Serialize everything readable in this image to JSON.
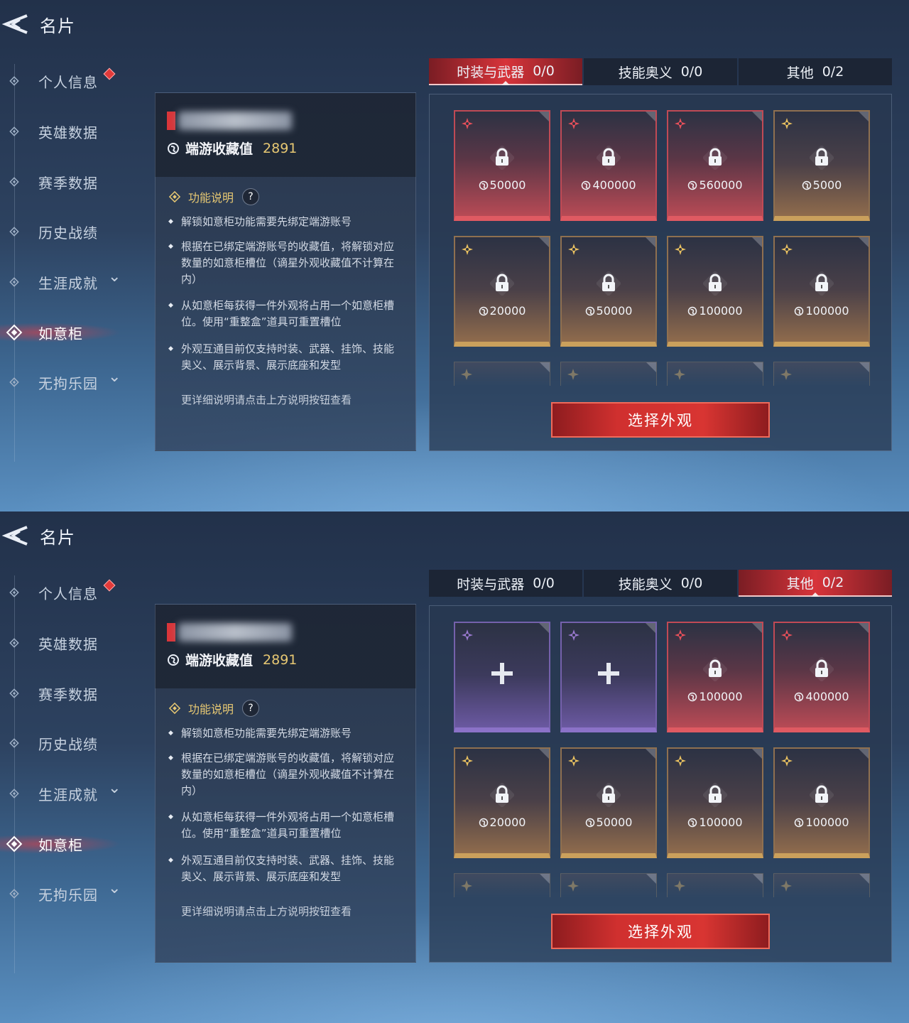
{
  "screens": [
    {
      "header": {
        "title": "名片"
      },
      "sidebar": {
        "items": [
          {
            "label": "个人信息",
            "has_dot": true,
            "has_chevron": false,
            "active": false
          },
          {
            "label": "英雄数据",
            "has_dot": false,
            "has_chevron": false,
            "active": false
          },
          {
            "label": "赛季数据",
            "has_dot": false,
            "has_chevron": false,
            "active": false
          },
          {
            "label": "历史战绩",
            "has_dot": false,
            "has_chevron": false,
            "active": false
          },
          {
            "label": "生涯成就",
            "has_dot": false,
            "has_chevron": true,
            "active": false
          },
          {
            "label": "如意柜",
            "has_dot": false,
            "has_chevron": false,
            "active": true
          },
          {
            "label": "无拘乐园",
            "has_dot": false,
            "has_chevron": true,
            "active": false
          }
        ]
      },
      "info": {
        "collect_label": "端游收藏值",
        "collect_value": "2891",
        "func_title": "功能说明",
        "help": "?",
        "bullets": [
          "解锁如意柜功能需要先绑定端游账号",
          "根据在已绑定端游账号的收藏值，将解锁对应数量的如意柜槽位（谪星外观收藏值不计算在内）",
          "从如意柜每获得一件外观将占用一个如意柜槽位。使用“重整盒”道具可重置槽位",
          "外观互通目前仅支持时装、武器、挂饰、技能奥义、展示背景、展示底座和发型"
        ],
        "more": "更详细说明请点击上方说明按钮查看"
      },
      "tabs": [
        {
          "label": "时装与武器",
          "count": "0/0",
          "active": true
        },
        {
          "label": "技能奥义",
          "count": "0/0",
          "active": false
        },
        {
          "label": "其他",
          "count": "0/2",
          "active": false
        }
      ],
      "slots": [
        {
          "rarity": "red",
          "state": "locked",
          "cost": "50000"
        },
        {
          "rarity": "red",
          "state": "locked",
          "cost": "400000"
        },
        {
          "rarity": "red",
          "state": "locked",
          "cost": "560000"
        },
        {
          "rarity": "gold",
          "state": "locked",
          "cost": "5000"
        },
        {
          "rarity": "gold",
          "state": "locked",
          "cost": "20000"
        },
        {
          "rarity": "gold",
          "state": "locked",
          "cost": "50000"
        },
        {
          "rarity": "gold",
          "state": "locked",
          "cost": "100000"
        },
        {
          "rarity": "gold",
          "state": "locked",
          "cost": "100000"
        }
      ],
      "select_button": "选择外观"
    },
    {
      "header": {
        "title": "名片"
      },
      "sidebar": {
        "items": [
          {
            "label": "个人信息",
            "has_dot": true,
            "has_chevron": false,
            "active": false
          },
          {
            "label": "英雄数据",
            "has_dot": false,
            "has_chevron": false,
            "active": false
          },
          {
            "label": "赛季数据",
            "has_dot": false,
            "has_chevron": false,
            "active": false
          },
          {
            "label": "历史战绩",
            "has_dot": false,
            "has_chevron": false,
            "active": false
          },
          {
            "label": "生涯成就",
            "has_dot": false,
            "has_chevron": true,
            "active": false
          },
          {
            "label": "如意柜",
            "has_dot": false,
            "has_chevron": false,
            "active": true
          },
          {
            "label": "无拘乐园",
            "has_dot": false,
            "has_chevron": true,
            "active": false
          }
        ]
      },
      "info": {
        "collect_label": "端游收藏值",
        "collect_value": "2891",
        "func_title": "功能说明",
        "help": "?",
        "bullets": [
          "解锁如意柜功能需要先绑定端游账号",
          "根据在已绑定端游账号的收藏值，将解锁对应数量的如意柜槽位（谪星外观收藏值不计算在内）",
          "从如意柜每获得一件外观将占用一个如意柜槽位。使用“重整盒”道具可重置槽位",
          "外观互通目前仅支持时装、武器、挂饰、技能奥义、展示背景、展示底座和发型"
        ],
        "more": "更详细说明请点击上方说明按钮查看"
      },
      "tabs": [
        {
          "label": "时装与武器",
          "count": "0/0",
          "active": false
        },
        {
          "label": "技能奥义",
          "count": "0/0",
          "active": false
        },
        {
          "label": "其他",
          "count": "0/2",
          "active": true
        }
      ],
      "slots": [
        {
          "rarity": "purple",
          "state": "empty",
          "cost": ""
        },
        {
          "rarity": "purple",
          "state": "empty",
          "cost": ""
        },
        {
          "rarity": "red",
          "state": "locked",
          "cost": "100000"
        },
        {
          "rarity": "red",
          "state": "locked",
          "cost": "400000"
        },
        {
          "rarity": "gold",
          "state": "locked",
          "cost": "20000"
        },
        {
          "rarity": "gold",
          "state": "locked",
          "cost": "50000"
        },
        {
          "rarity": "gold",
          "state": "locked",
          "cost": "100000"
        },
        {
          "rarity": "gold",
          "state": "locked",
          "cost": "100000"
        }
      ],
      "select_button": "选择外观"
    }
  ],
  "colors": {
    "accent_red": "#d7343a",
    "gold_text": "#e7c873",
    "slot_red": "#df5a62",
    "slot_gold": "#caa05c",
    "slot_purple": "#8b72c8"
  },
  "icons": [
    "back-arrow-icon",
    "diamond-bullet-icon",
    "chevron-down-icon",
    "collect-coin-icon",
    "func-diamond-icon",
    "lock-icon",
    "plus-icon",
    "rarity-star-icon"
  ]
}
